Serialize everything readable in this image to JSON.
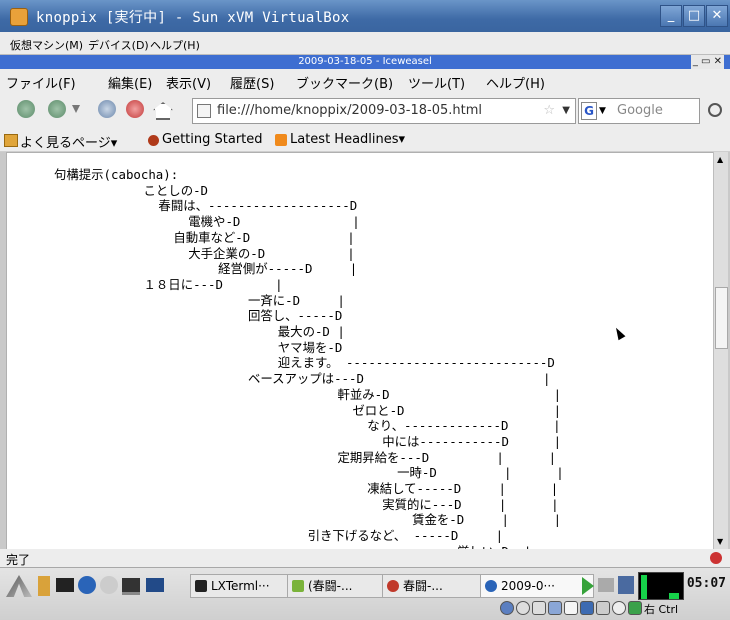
{
  "vbox": {
    "title": "knoppix [実行中] - Sun xVM VirtualBox",
    "menu": [
      "仮想マシン(M)",
      "デバイス(D)",
      "ヘルプ(H)"
    ]
  },
  "browser": {
    "title": "2009-03-18-05 - Iceweasel",
    "menu": [
      "ファイル(F)",
      "編集(E)",
      "表示(V)",
      "履歴(S)",
      "ブックマーク(B)",
      "ツール(T)",
      "ヘルプ(H)"
    ],
    "url": "file:///home/knoppix/2009-03-18-05.html",
    "search_placeholder": "Google",
    "bookmarks": [
      "よく見るページ▾",
      "Getting Started",
      "Latest Headlines▾"
    ],
    "status": "完了"
  },
  "content": {
    "lines": [
      "句構提示(cabocha):",
      "            ことしの-D",
      "              春闘は、-------------------D",
      "                  電機や-D               |",
      "                自動車など-D             |",
      "                  大手企業の-D           |",
      "                      経営側が-----D     |",
      "            １８日に---D       |",
      "                          一斉に-D     |",
      "                          回答し、-----D",
      "                              最大の-D |",
      "                              ヤマ場を-D",
      "                              迎えます。 ---------------------------D",
      "                          ベースアップは---D                        |",
      "                                      軒並み-D                      |",
      "                                        ゼロと-D                    |",
      "                                          なり、-------------D      |",
      "                                            中には-----------D      |",
      "                                      定期昇給を---D         |      |",
      "                                              一時-D         |      |",
      "                                          凍結して-----D     |      |",
      "                                            実質的に---D     |      |",
      "                                                賃金を-D     |      |",
      "                                  引き下げるなど、 -----D     |",
      "                                                      厳しい-D  |"
    ]
  },
  "taskbar": {
    "tasks": [
      "LXTerml···",
      "(春闘-...",
      "春闘-...",
      "2009-0···"
    ],
    "clock": "05:07",
    "tray_label": "右 Ctrl"
  },
  "colors": {
    "vbox_title": "#3e6aa6",
    "browser_title": "#3e6ed1",
    "chrome": "#ededed"
  }
}
